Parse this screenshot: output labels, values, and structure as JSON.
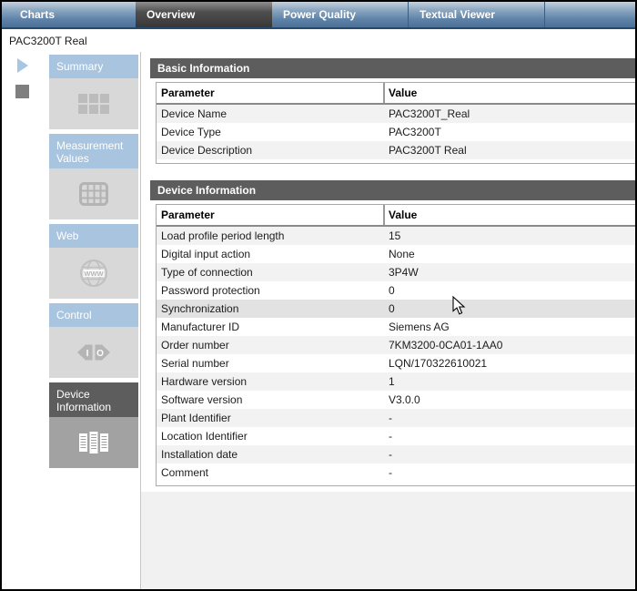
{
  "tabs": [
    {
      "label": "Charts",
      "selected": false
    },
    {
      "label": "Overview",
      "selected": true
    },
    {
      "label": "Power Quality",
      "selected": false
    },
    {
      "label": "Textual Viewer",
      "selected": false
    }
  ],
  "device_label": "PAC3200T Real",
  "media_controls": {
    "play_icon": "play-icon",
    "stop_icon": "stop-icon"
  },
  "sidebar": {
    "items": [
      {
        "label": "Summary",
        "icon": "summary-grid-icon",
        "selected": false
      },
      {
        "label": "Measurement Values",
        "icon": "measurement-table-icon",
        "selected": false
      },
      {
        "label": "Web",
        "icon": "web-globe-icon",
        "selected": false
      },
      {
        "label": "Control",
        "icon": "control-io-icon",
        "selected": false
      },
      {
        "label": "Device Information",
        "icon": "device-documents-icon",
        "selected": true
      }
    ]
  },
  "sections": [
    {
      "title": "Basic Information",
      "columns": [
        "Parameter",
        "Value"
      ],
      "rows": [
        [
          "Device Name",
          "PAC3200T_Real"
        ],
        [
          "Device Type",
          "PAC3200T"
        ],
        [
          "Device Description",
          "PAC3200T Real"
        ]
      ],
      "hover_row": null
    },
    {
      "title": "Device Information",
      "columns": [
        "Parameter",
        "Value"
      ],
      "rows": [
        [
          "Load profile period length",
          "15"
        ],
        [
          "Digital input action",
          "None"
        ],
        [
          "Type of connection",
          "3P4W"
        ],
        [
          "Password protection",
          "0"
        ],
        [
          "Synchronization",
          "0"
        ],
        [
          "Manufacturer ID",
          "Siemens AG"
        ],
        [
          "Order number",
          "7KM3200-0CA01-1AA0"
        ],
        [
          "Serial number",
          "LQN/170322610021"
        ],
        [
          "Hardware version",
          "1"
        ],
        [
          "Software version",
          "V3.0.0"
        ],
        [
          "Plant Identifier",
          "-"
        ],
        [
          "Location Identifier",
          "-"
        ],
        [
          "Installation date",
          "-"
        ],
        [
          "Comment",
          "-"
        ]
      ],
      "hover_row": 4
    }
  ],
  "colors": {
    "tab_bar_top": "#c6d1dc",
    "tab_bar_bottom": "#4d7096",
    "tab_bar_edge": "#24496f",
    "selected_tab": "#3f3f3f",
    "nav_header_blue": "#a9c4de",
    "selected_dark": "#5d5d5d",
    "nav_body_gray": "#d8d8d8",
    "selected_body_gray": "#a2a2a2",
    "row_alt": "#f2f2f2",
    "row_hover": "#e2e2e2",
    "table_border": "#a8a8a8",
    "bottom_filler": "#f1f1f1"
  }
}
